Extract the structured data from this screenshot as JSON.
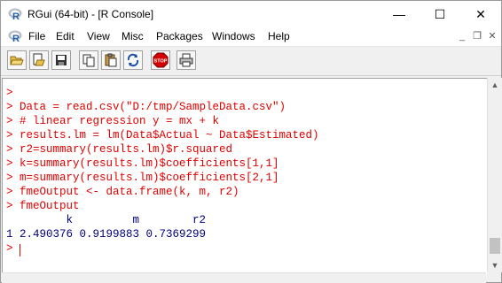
{
  "window": {
    "title": "RGui (64-bit) - [R Console]",
    "minimize_glyph": "—",
    "maximize_glyph": "☐",
    "close_glyph": "✕"
  },
  "menu": {
    "items": [
      "File",
      "Edit",
      "View",
      "Misc",
      "Packages",
      "Windows",
      "Help"
    ],
    "mdi_minimize": "_",
    "mdi_restore": "❐",
    "mdi_close": "✕"
  },
  "toolbar": {
    "buttons": [
      "open-script-icon",
      "load-workspace-icon",
      "save-icon",
      "copy-icon",
      "paste-icon",
      "copy-paste-icon",
      "stop-icon",
      "print-icon"
    ],
    "stop_label": "STOP"
  },
  "console": {
    "lines": [
      {
        "text": ">",
        "color": "red"
      },
      {
        "text": "> Data = read.csv(\"D:/tmp/SampleData.csv\")",
        "color": "red"
      },
      {
        "text": "> # linear regression y = mx + k",
        "color": "red"
      },
      {
        "text": "> results.lm = lm(Data$Actual ~ Data$Estimated)",
        "color": "red"
      },
      {
        "text": "> r2=summary(results.lm)$r.squared",
        "color": "red"
      },
      {
        "text": "> k=summary(results.lm)$coefficients[1,1]",
        "color": "red"
      },
      {
        "text": "> m=summary(results.lm)$coefficients[2,1]",
        "color": "red"
      },
      {
        "text": "> fmeOutput <- data.frame(k, m, r2)",
        "color": "red"
      },
      {
        "text": "> fmeOutput",
        "color": "red"
      },
      {
        "text": "         k         m        r2",
        "color": "blue"
      },
      {
        "text": "1 2.490376 0.9199883 0.7369299",
        "color": "blue"
      },
      {
        "text": "> ",
        "color": "red"
      }
    ]
  },
  "colors": {
    "prompt_red": "#e00000",
    "output_blue": "#000080"
  }
}
